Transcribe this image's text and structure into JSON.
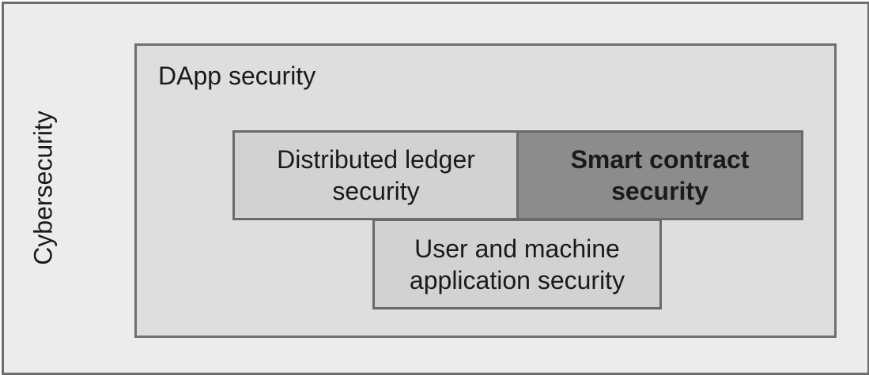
{
  "outer": {
    "label": "Cybersecurity"
  },
  "dapp": {
    "label": "DApp security"
  },
  "boxes": {
    "ledger": {
      "line1": "Distributed ledger",
      "line2": "security"
    },
    "smart": {
      "line1": "Smart contract",
      "line2": "security"
    },
    "user": {
      "line1": "User and machine",
      "line2": "application security"
    }
  },
  "colors": {
    "outer_fill": "#ececec",
    "dapp_fill": "#dedede",
    "box_fill": "#d2d2d2",
    "highlight_fill": "#8c8c8c",
    "border": "#6e6e6e"
  }
}
